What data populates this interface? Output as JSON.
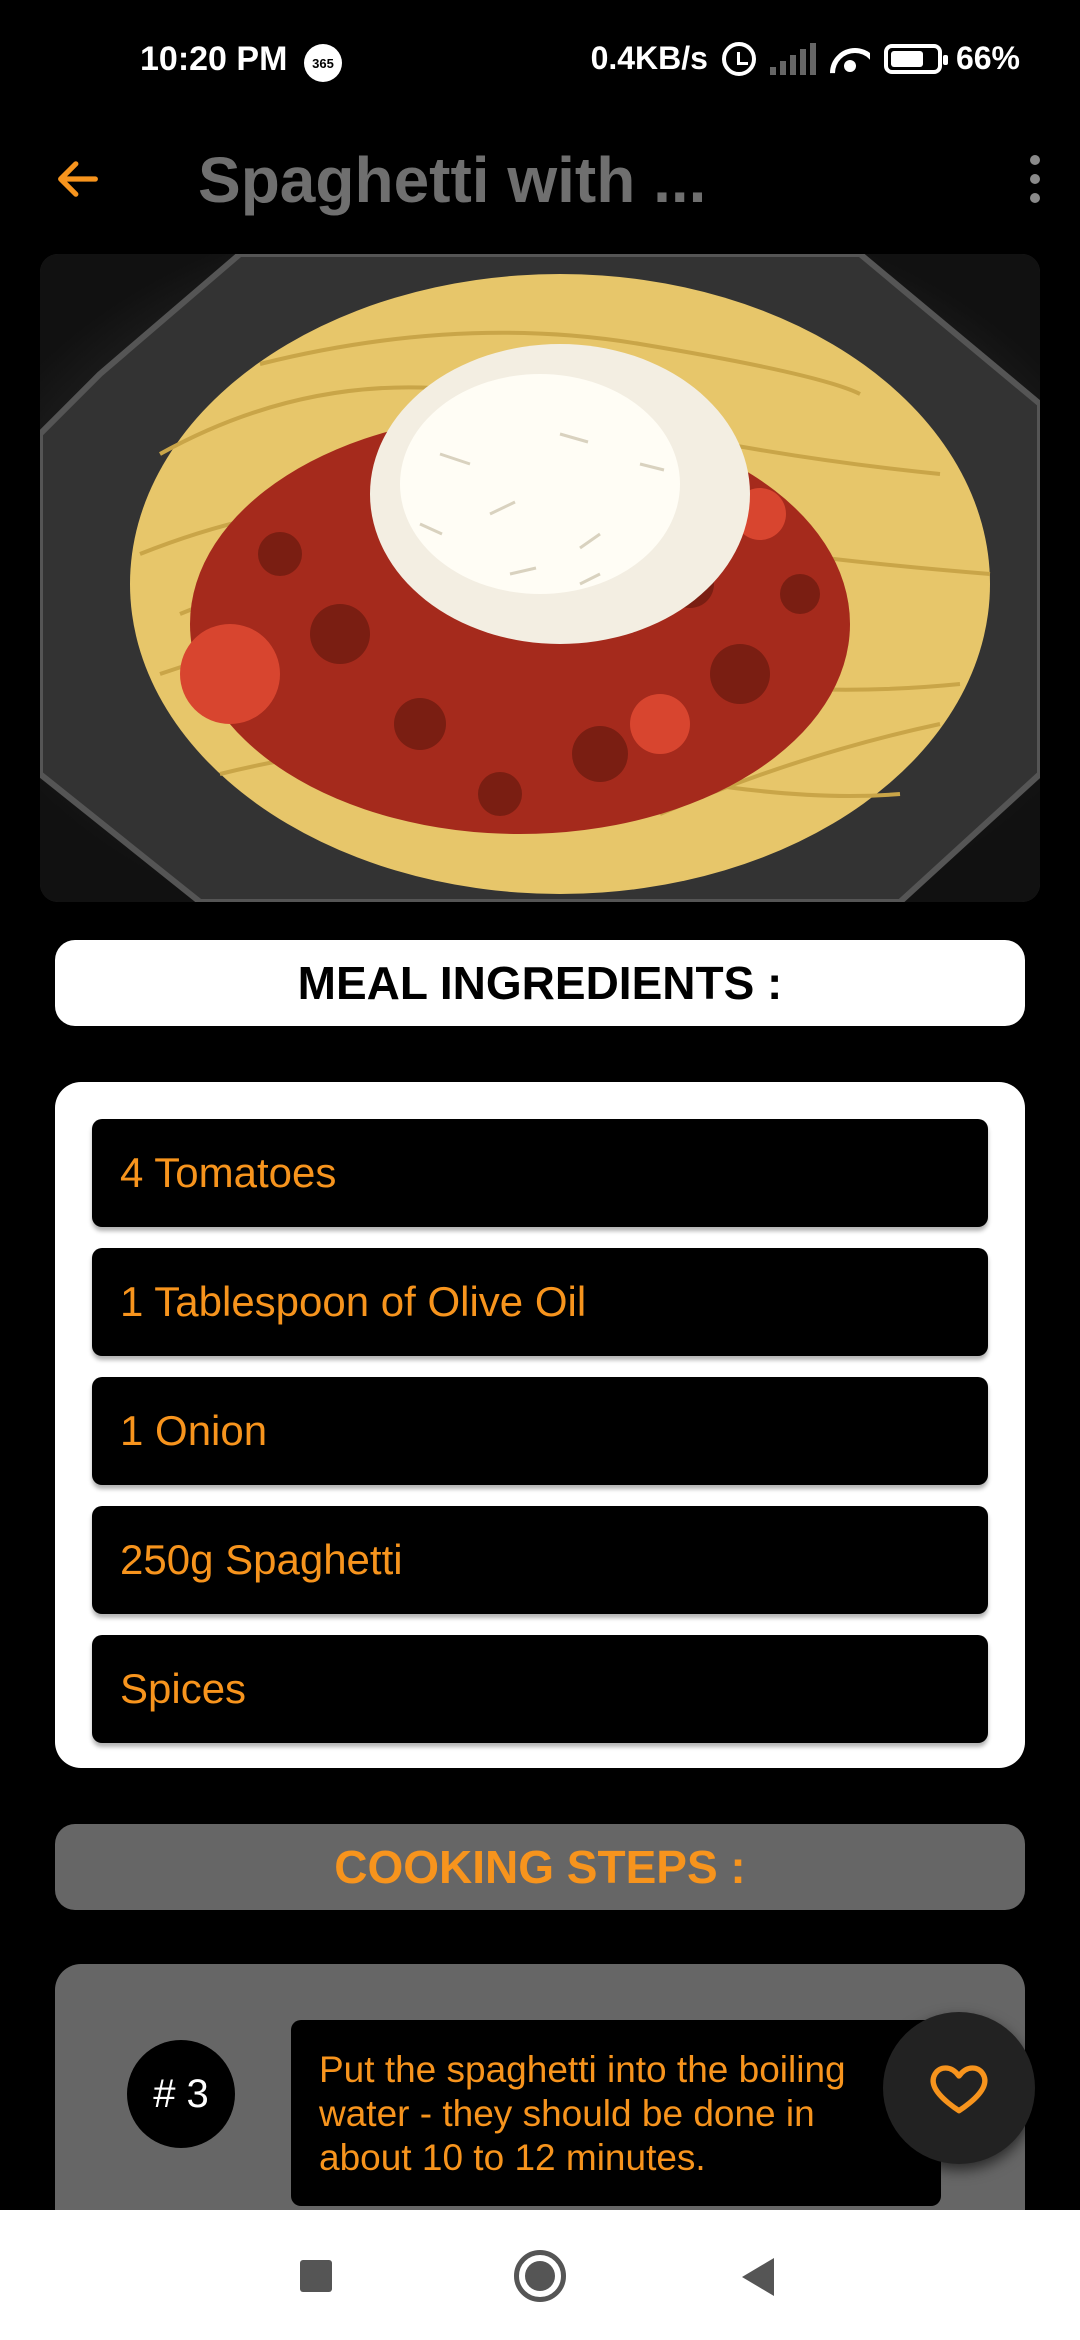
{
  "status_bar": {
    "time": "10:20 PM",
    "badge": "365",
    "net_speed": "0.4KB/s",
    "battery": "66%"
  },
  "app_bar": {
    "title": "Spaghetti with ...",
    "back_icon": "arrow-left-icon",
    "menu_icon": "more-vert-icon"
  },
  "hero": {
    "icon": "meal-photo"
  },
  "ingredients": {
    "header": "MEAL INGREDIENTS :",
    "items": [
      "4 Tomatoes",
      "1 Tablespoon of Olive Oil",
      "1 Onion",
      "250g Spaghetti",
      "Spices"
    ]
  },
  "steps": {
    "header": "COOKING STEPS :",
    "current": {
      "number": "# 3",
      "text": "Put the spaghetti into the boiling water - they should be done in about 10 to 12 minutes."
    }
  },
  "fab": {
    "icon": "heart-icon"
  },
  "colors": {
    "accent": "#f7941d",
    "background": "#000000",
    "card": "#ffffff",
    "muted": "#666666"
  }
}
